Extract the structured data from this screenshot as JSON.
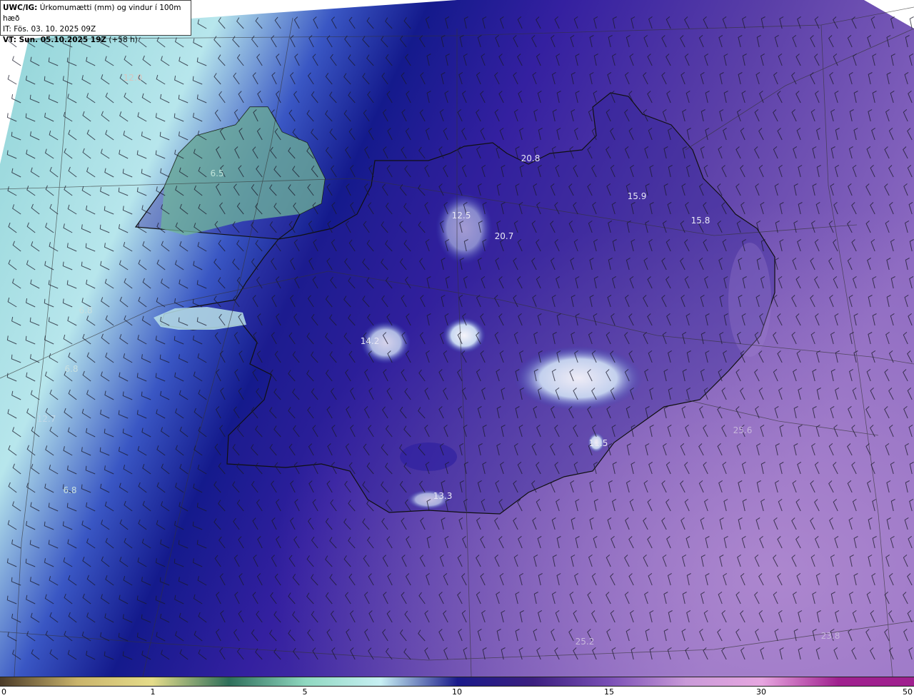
{
  "header": {
    "model": "UWC/IG:",
    "title": "Úrkomumætti (mm) og vindur í 100m hæð",
    "issue_time": "IT: Fös. 03. 10. 2025 09Z",
    "valid_prefix": "VT: Sun. 05.10.2025 19Z",
    "valid_offset": "(+58 h)"
  },
  "map_labels": [
    {
      "text": "12.0",
      "color": "#d7c6c0"
    },
    {
      "text": "6.5",
      "color": "#bfe3d8"
    },
    {
      "text": "20.8",
      "color": "#e8e8f5"
    },
    {
      "text": "15.9",
      "color": "#e8e8f5"
    },
    {
      "text": "15.8",
      "color": "#e8e8f5"
    },
    {
      "text": "12.5",
      "color": "#e8e8f5"
    },
    {
      "text": "20.7",
      "color": "#e8e8f5"
    },
    {
      "text": "14.2",
      "color": "#e8e8f5"
    },
    {
      "text": "11.5",
      "color": "#e8e8f5"
    },
    {
      "text": "25.6",
      "color": "#c8b8dc"
    },
    {
      "text": "13.3",
      "color": "#e8e8f5"
    },
    {
      "text": "25.2",
      "color": "#c8b8dc"
    },
    {
      "text": "23.8",
      "color": "#c8b8dc"
    },
    {
      "text": "12.7",
      "color": "#c0d8e8"
    },
    {
      "text": "6.8",
      "color": "#c8e0e0"
    },
    {
      "text": "6.8",
      "color": "#c8e0e0"
    },
    {
      "text": "6.8",
      "color": "#c8e0e0"
    }
  ],
  "colorbar": {
    "ticks": [
      "0",
      "1",
      "5",
      "10",
      "15",
      "30",
      "50"
    ],
    "colors": [
      "#4a3a28",
      "#c9b36a",
      "#e6dd8a",
      "#2d6e5a",
      "#8fd8c0",
      "#c8f0f4",
      "#1a1a8a",
      "#3c1f80",
      "#7a4fb6",
      "#c99ad8",
      "#e7a6e0",
      "#a0208f"
    ]
  }
}
